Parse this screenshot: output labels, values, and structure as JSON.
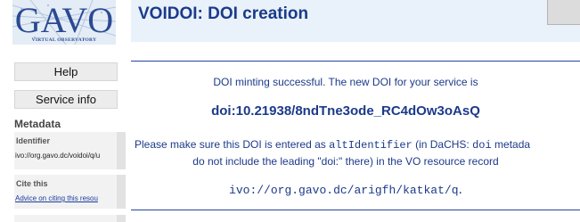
{
  "sidebar": {
    "logo_text": "GAVO",
    "logo_subtext": "Virtual Observatory",
    "help_label": "Help",
    "service_info_label": "Service info",
    "metadata_heading": "Metadata",
    "identifier_label": "Identifier",
    "identifier_value": "ivo://org.gavo.dc/voidoi/q/u",
    "cite_label": "Cite this",
    "cite_link": "Advice on citing this resou"
  },
  "main": {
    "title": "VOIDOI: DOI creation",
    "success_message": "DOI minting successful. The new DOI for your service is",
    "doi": "doi:10.21938/8ndTne3ode_RC4dOw3oAsQ",
    "instr_part1": "Please make sure this DOI is entered as ",
    "instr_code1": "altIdentifier",
    "instr_part2": " (in DaCHS: ",
    "instr_code2": "doi",
    "instr_part3": " metada",
    "instr_line2": "do not include the leading \"doi:\" there) in the VO resource record",
    "ivoid": "ivo://org.gavo.dc/arigfh/katkat/q",
    "ivoid_suffix": "."
  },
  "colors": {
    "heading_blue": "#1b3a8a",
    "header_bg": "#e9f1fa",
    "rule": "#24469a"
  }
}
